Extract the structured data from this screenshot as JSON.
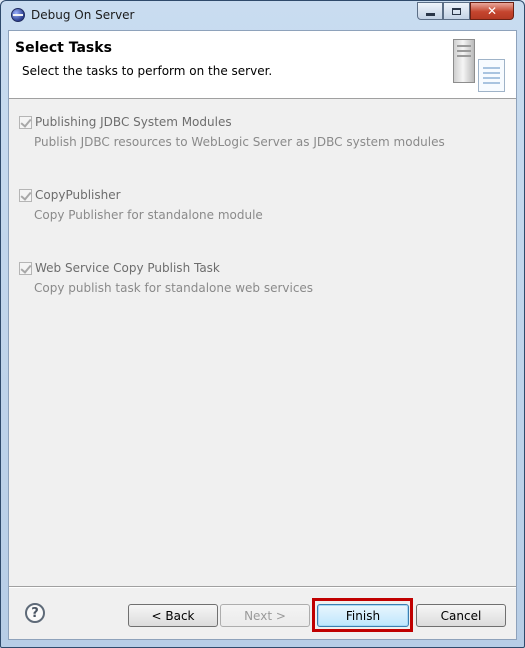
{
  "window": {
    "title": "Debug On Server",
    "close_glyph": "✕"
  },
  "header": {
    "title": "Select Tasks",
    "description": "Select the tasks to perform on the server.",
    "icon": "server-icon"
  },
  "tasks": [
    {
      "label": "Publishing JDBC System Modules",
      "description": "Publish JDBC resources to WebLogic Server as JDBC system modules",
      "checked": true
    },
    {
      "label": "CopyPublisher",
      "description": "Copy Publisher for standalone module",
      "checked": true
    },
    {
      "label": "Web Service Copy Publish Task",
      "description": "Copy publish task for standalone web services",
      "checked": true
    }
  ],
  "footer": {
    "help_glyph": "?",
    "back_label": "< Back",
    "next_label": "Next >",
    "finish_label": "Finish",
    "cancel_label": "Cancel"
  },
  "colors": {
    "highlight": "#c00000",
    "disabled_text": "#8a8a8a"
  }
}
